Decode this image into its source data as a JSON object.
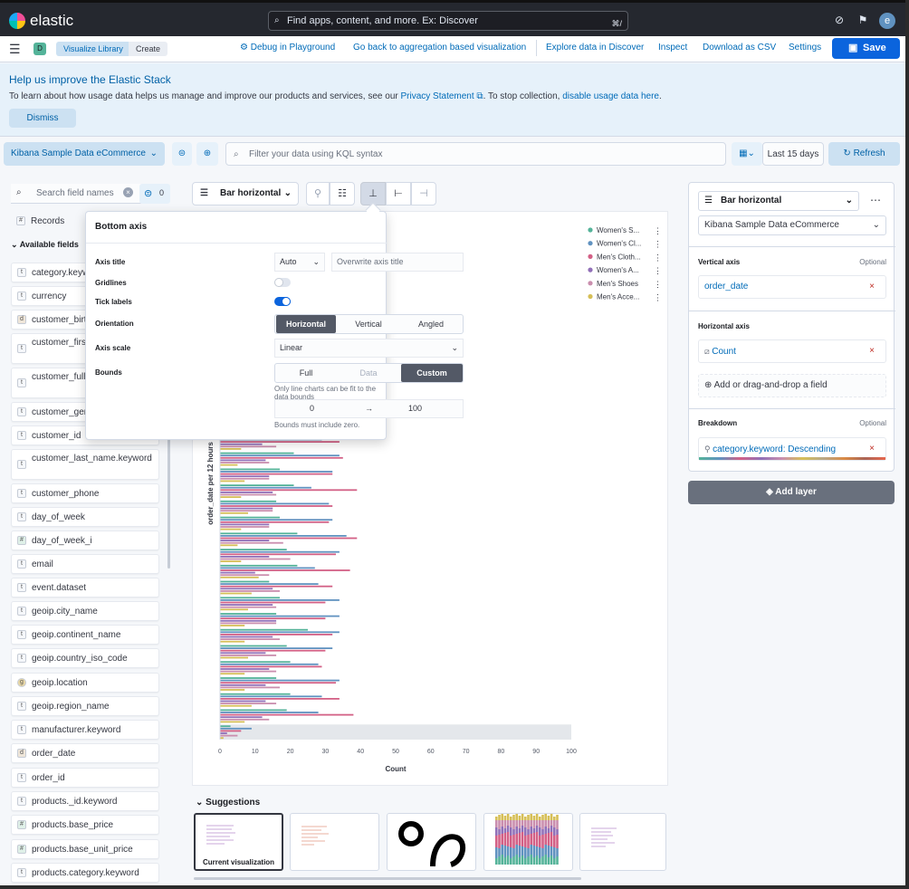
{
  "header": {
    "brand": "elastic",
    "search_placeholder": "Find apps, content, and more. Ex: Discover",
    "search_shortcut": "⌘/",
    "avatar_initial": "e"
  },
  "nav": {
    "space_initial": "D",
    "breadcrumbs": [
      "Visualize Library",
      "Create"
    ],
    "links": {
      "debug": "Debug in Playground",
      "back": "Go back to aggregation based visualization",
      "explore": "Explore data in Discover",
      "inspect": "Inspect",
      "download": "Download as CSV",
      "settings": "Settings"
    },
    "save_label": "Save"
  },
  "callout": {
    "title": "Help us improve the Elastic Stack",
    "body_prefix": "To learn about how usage data helps us manage and improve our products and services, see our ",
    "privacy_link": "Privacy Statement",
    "body_middle": ". To stop collection, ",
    "disable_link": "disable usage data here",
    "body_suffix": ".",
    "dismiss_label": "Dismiss"
  },
  "querybar": {
    "dataview": "Kibana Sample Data eCommerce",
    "query_placeholder": "Filter your data using KQL syntax",
    "time_range": "Last 15 days",
    "refresh_label": "Refresh"
  },
  "fields": {
    "search_placeholder": "Search field names",
    "filter_count": "0",
    "records_label": "Records",
    "available_label": "Available fields",
    "items": [
      {
        "type": "t",
        "name": "category.keyword"
      },
      {
        "type": "t",
        "name": "currency"
      },
      {
        "type": "d",
        "name": "customer_birth_date"
      },
      {
        "type": "t",
        "name": "customer_first_name.keyword"
      },
      {
        "type": "t",
        "name": "customer_full_name.keyword"
      },
      {
        "type": "t",
        "name": "customer_gender"
      },
      {
        "type": "t",
        "name": "customer_id"
      },
      {
        "type": "t",
        "name": "customer_last_name.keyword"
      },
      {
        "type": "t",
        "name": "customer_phone"
      },
      {
        "type": "t",
        "name": "day_of_week"
      },
      {
        "type": "#",
        "name": "day_of_week_i"
      },
      {
        "type": "t",
        "name": "email"
      },
      {
        "type": "t",
        "name": "event.dataset"
      },
      {
        "type": "t",
        "name": "geoip.city_name"
      },
      {
        "type": "t",
        "name": "geoip.continent_name"
      },
      {
        "type": "t",
        "name": "geoip.country_iso_code"
      },
      {
        "type": "g",
        "name": "geoip.location"
      },
      {
        "type": "t",
        "name": "geoip.region_name"
      },
      {
        "type": "t",
        "name": "manufacturer.keyword"
      },
      {
        "type": "d",
        "name": "order_date"
      },
      {
        "type": "t",
        "name": "order_id"
      },
      {
        "type": "t",
        "name": "products._id.keyword"
      },
      {
        "type": "#",
        "name": "products.base_price"
      },
      {
        "type": "#",
        "name": "products.base_unit_price"
      },
      {
        "type": "t",
        "name": "products.category.keyword"
      }
    ]
  },
  "toolbar": {
    "chart_type": "Bar horizontal"
  },
  "popover": {
    "title": "Bottom axis",
    "axis_title_label": "Axis title",
    "axis_title_mode": "Auto",
    "axis_title_placeholder": "Overwrite axis title",
    "gridlines_label": "Gridlines",
    "gridlines_on": false,
    "tick_labels_label": "Tick labels",
    "tick_labels_on": true,
    "orientation_label": "Orientation",
    "orientation_options": [
      "Horizontal",
      "Vertical",
      "Angled"
    ],
    "orientation_selected": "Horizontal",
    "axis_scale_label": "Axis scale",
    "axis_scale": "Linear",
    "bounds_label": "Bounds",
    "bounds_options": [
      "Full",
      "Data",
      "Custom"
    ],
    "bounds_selected": "Custom",
    "bounds_help": "Only line charts can be fit to the data bounds",
    "bound_min": "0",
    "bound_arrow": "→",
    "bound_max": "100",
    "bounds_note": "Bounds must include zero."
  },
  "chart_data": {
    "type": "bar",
    "orientation": "horizontal",
    "xlabel": "Count",
    "ylabel": "order_date per 12 hours",
    "xlim": [
      0,
      100
    ],
    "xticks": [
      "0",
      "10",
      "20",
      "30",
      "40",
      "50",
      "60",
      "70",
      "80",
      "90",
      "100"
    ],
    "legend_position": "top-right",
    "series": [
      {
        "name": "Women's S...",
        "color": "#54b399",
        "values": [
          19,
          21,
          17,
          21,
          16,
          17,
          22,
          19,
          22,
          14,
          17,
          16,
          25,
          19,
          20,
          16,
          20,
          19,
          3
        ]
      },
      {
        "name": "Women's Cl...",
        "color": "#6092c0",
        "values": [
          29,
          34,
          32,
          26,
          31,
          32,
          36,
          34,
          27,
          28,
          34,
          34,
          34,
          32,
          28,
          34,
          29,
          28,
          9
        ]
      },
      {
        "name": "Men's Cloth...",
        "color": "#d36086",
        "values": [
          34,
          35,
          32,
          39,
          32,
          31,
          39,
          33,
          37,
          32,
          30,
          30,
          32,
          30,
          29,
          33,
          34,
          38,
          6
        ]
      },
      {
        "name": "Women's A...",
        "color": "#9170b8",
        "values": [
          12,
          13,
          14,
          15,
          15,
          14,
          14,
          14,
          10,
          15,
          15,
          16,
          15,
          13,
          14,
          13,
          13,
          12,
          2
        ]
      },
      {
        "name": "Men's Shoes",
        "color": "#ca8eae",
        "values": [
          16,
          14,
          14,
          16,
          15,
          14,
          18,
          20,
          14,
          17,
          16,
          16,
          17,
          16,
          16,
          17,
          16,
          14,
          5
        ]
      },
      {
        "name": "Men's Acce...",
        "color": "#d6bf57",
        "values": [
          6,
          5,
          7,
          6,
          8,
          6,
          5,
          6,
          11,
          9,
          8,
          7,
          7,
          8,
          7,
          7,
          9,
          7,
          1
        ]
      }
    ]
  },
  "layer": {
    "chart_type": "Bar horizontal",
    "dataview": "Kibana Sample Data eCommerce",
    "vertical_axis_title": "Vertical axis",
    "vertical_axis_optional": "Optional",
    "vertical_axis_field": "order_date",
    "horizontal_axis_title": "Horizontal axis",
    "horizontal_axis_field": "Count",
    "add_field_label": "Add or drag-and-drop a field",
    "breakdown_title": "Breakdown",
    "breakdown_optional": "Optional",
    "breakdown_field": "category.keyword: Descending",
    "add_layer_label": "Add layer"
  },
  "suggestions": {
    "title": "Suggestions",
    "current_label": "Current visualization"
  }
}
